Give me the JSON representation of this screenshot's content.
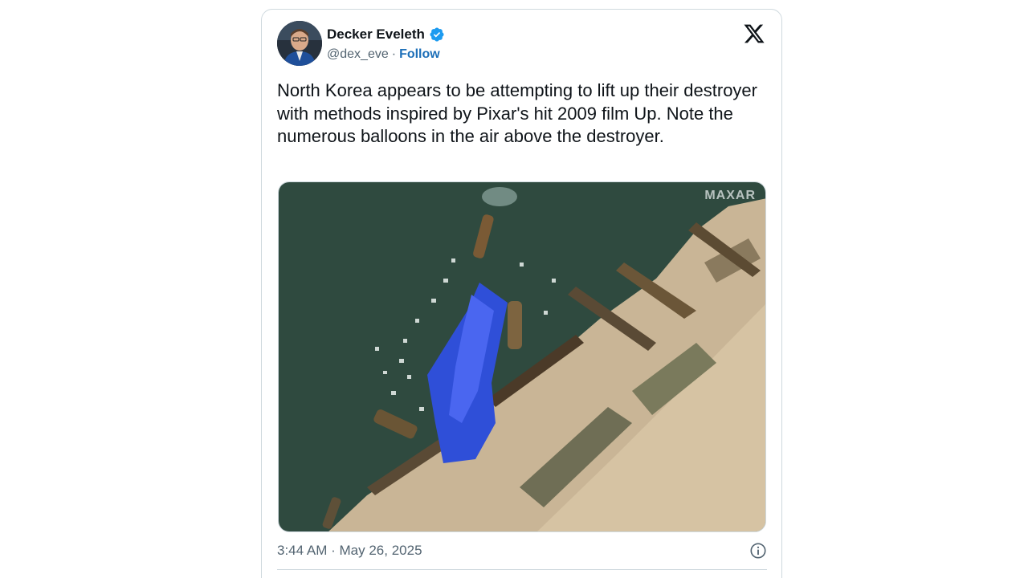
{
  "author": {
    "name": "Decker Eveleth",
    "handle": "@dex_eve",
    "separator": "·",
    "follow_label": "Follow",
    "verified": true
  },
  "tweet": {
    "text": "North Korea appears to be attempting to lift up their destroyer with methods inspired by Pixar's hit 2009 film Up. Note the numerous balloons in the air above the destroyer.",
    "time": "3:44 AM",
    "date_separator": "·",
    "date": "May 26, 2025"
  },
  "media": {
    "watermark": "MAXAR",
    "description_colors": {
      "water": "#2f4a3f",
      "land": "#c9b596",
      "tarp": "#2f4fd8"
    }
  },
  "icons": {
    "brand": "x-logo-icon",
    "verified": "verified-badge-icon",
    "info": "info-icon"
  },
  "colors": {
    "accent": "#1d6fb8",
    "verified": "#1d9bf0",
    "muted": "#536471",
    "border": "#cfd9de"
  }
}
